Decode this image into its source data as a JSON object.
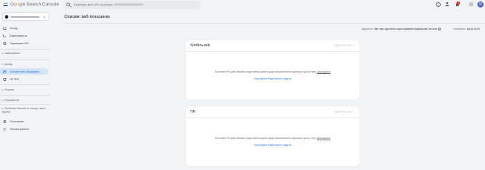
{
  "header": {
    "logo_google": [
      "G",
      "o",
      "o",
      "g",
      "l",
      "e"
    ],
    "logo_rest": " Search Console",
    "search_placeholder": "Перевірка всіх URL на ресурсі",
    "notification_count": "2",
    "avatar_letter": "G",
    "help_glyph": "?"
  },
  "property": {
    "chevron": "▾"
  },
  "sidebar": {
    "overview": "Огляд",
    "performance": "Ефективність",
    "url_inspection": "Перевірка URL",
    "indexing": "Індексування",
    "experience": "Досвід",
    "cwv": "Основні веб-показники",
    "https": "HTTPS",
    "shopping": "Покупки",
    "enhancements": "Покращення",
    "security": "Проблеми безпеки та заходи, вжиті вручну",
    "links": "Посилання",
    "settings": "Налаштування",
    "collapse_tri": "▸",
    "expand_tri": "▾"
  },
  "main": {
    "title": "Основні веб-показники",
    "source_label": "Джерело:",
    "source_value": "Звіт про зручність користування браузером Chrome",
    "updated_label": "Оновлено:",
    "updated_value": "16.04.2025"
  },
  "cards": [
    {
      "title": "Мобільний",
      "open_report": "ВІДКРИТИ ЗВІТ",
      "message": "За останні 90 днів зібрано недостатньо даних щодо використання пристрою цього типу.",
      "more": "Докладніше",
      "psi": "Спробуйте PageSpeed Insights"
    },
    {
      "title": "ПК",
      "open_report": "ВІДКРИТИ ЗВІТ",
      "message": "За останні 90 днів зібрано недостатньо даних щодо використання пристрою цього типу.",
      "more": "Докладніше",
      "psi": "Спробуйте PageSpeed Insights"
    }
  ]
}
